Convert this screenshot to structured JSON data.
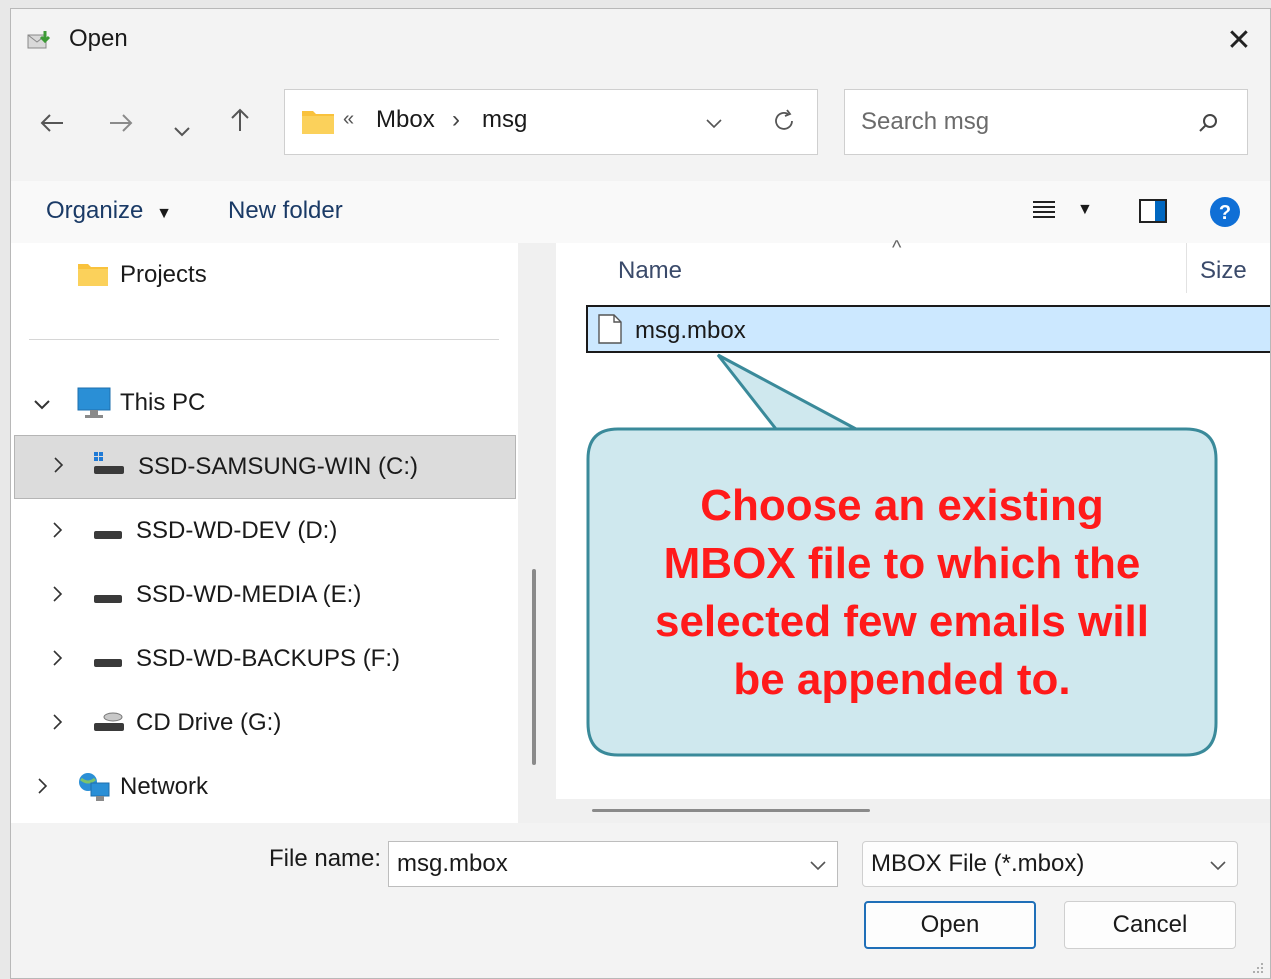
{
  "window": {
    "title": "Open"
  },
  "nav": {
    "back_icon": "arrow-left-icon",
    "forward_icon": "arrow-right-icon",
    "recent_icon": "chevron-down-icon",
    "up_icon": "arrow-up-icon"
  },
  "address": {
    "overflow": "«",
    "segments": [
      "Mbox",
      "msg"
    ],
    "separator": "›"
  },
  "search": {
    "placeholder": "Search msg"
  },
  "toolbar": {
    "organize": "Organize",
    "new_folder": "New folder"
  },
  "sidebar": {
    "quick_item": "Projects",
    "this_pc": "This PC",
    "drives": [
      {
        "label": "SSD-SAMSUNG-WIN (C:)",
        "selected": true
      },
      {
        "label": "SSD-WD-DEV (D:)"
      },
      {
        "label": "SSD-WD-MEDIA (E:)"
      },
      {
        "label": "SSD-WD-BACKUPS (F:)"
      },
      {
        "label": "CD Drive (G:)"
      }
    ],
    "network": "Network"
  },
  "files": {
    "columns": {
      "name": "Name",
      "size": "Size"
    },
    "items": [
      {
        "name": "msg.mbox",
        "selected": true
      }
    ]
  },
  "callout": {
    "lines": [
      "Choose an existing",
      "MBOX file to which the",
      "selected few emails will",
      "be appended to."
    ],
    "color": "#ff1a1a",
    "fill": "#cfe8ee",
    "border": "#3a8a9a"
  },
  "bottom": {
    "file_name_label": "File name:",
    "file_name_value": "msg.mbox",
    "file_type": "MBOX File (*.mbox)",
    "open": "Open",
    "cancel": "Cancel"
  },
  "colors": {
    "accent": "#0067c0",
    "selection": "#cce8ff",
    "folder": "#f9c23c"
  }
}
